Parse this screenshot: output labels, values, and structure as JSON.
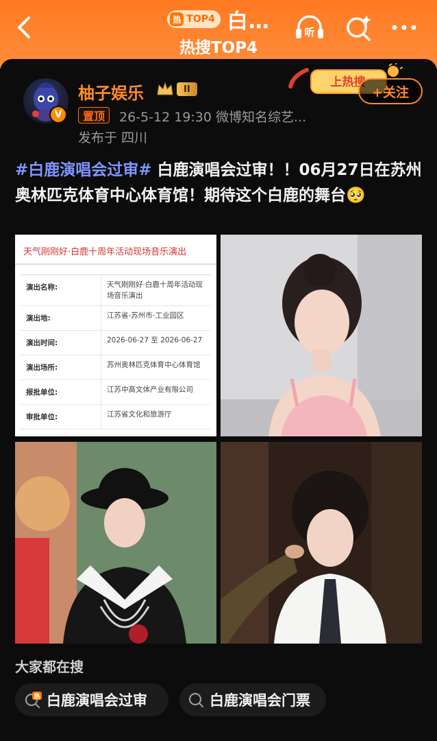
{
  "header": {
    "badge_label": "TOP4",
    "badge_fire": "热",
    "title": "白…",
    "subtitle": "热搜TOP4",
    "icons": [
      "back-arrow-icon",
      "headphones-icon",
      "search-sparkle-icon",
      "more-dots-icon"
    ],
    "listen_label": "听"
  },
  "post": {
    "username": "柚子娱乐",
    "level_badge": "II",
    "verified_mark": "V",
    "pin_label": "置顶",
    "meta": "26-5-12 19:30  微博知名综艺...",
    "location": "发布于 四川",
    "hot_sticker_label": "上热搜",
    "follow_label": "+关注",
    "hashtag": "#白鹿演唱会过审#",
    "body": " 白鹿演唱会过审！！06月27日在苏州奥林匹克体育中心体育馆！期待这个白鹿的舞台",
    "emoji": "🥺"
  },
  "document_image": {
    "header": "天气刚刚好·白鹿十周年活动现场音乐演出",
    "rows": [
      {
        "key": "演出名称:",
        "value": "天气刚刚好·白鹿十周年活动现场音乐演出"
      },
      {
        "key": "演出地:",
        "value": "江苏省-苏州市-工业园区"
      },
      {
        "key": "演出时间:",
        "value": "2026-06-27 至 2026-06-27"
      },
      {
        "key": "演出场所:",
        "value": "苏州奥林匹克体育中心体育馆"
      },
      {
        "key": "报批单位:",
        "value": "江苏中高文体产业有限公司"
      },
      {
        "key": "审批单位:",
        "value": "江苏省文化和旅游厅"
      }
    ]
  },
  "search_section": {
    "title": "大家都在搜",
    "chips": [
      {
        "label": "白鹿演唱会过审",
        "icon": "hot-search-icon"
      },
      {
        "label": "白鹿演唱会门票",
        "icon": "search-icon"
      }
    ]
  },
  "colors": {
    "header_orange": "#ff7a22",
    "username_orange": "#ff8a2a",
    "hashtag_blue": "#7f95ff",
    "card_bg": "#0c0c0c"
  }
}
